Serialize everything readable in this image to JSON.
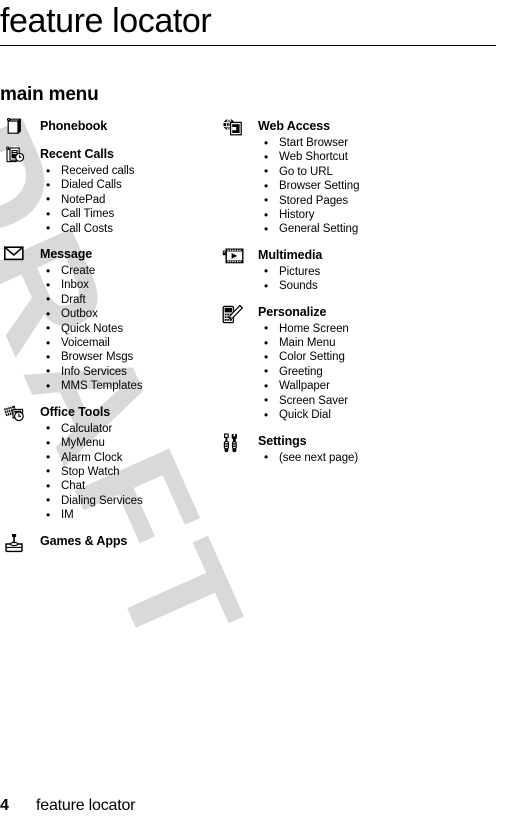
{
  "document": {
    "title": "feature locator",
    "section_heading": "main menu",
    "watermark_text": "DRAFT",
    "watermark_color": "#d9d9d9"
  },
  "footer": {
    "page_number": "4",
    "label": "feature locator"
  },
  "columns": {
    "left": [
      {
        "icon": "phonebook-icon",
        "label": "Phonebook",
        "items": []
      },
      {
        "icon": "recent-calls-icon",
        "label": "Recent Calls",
        "items": [
          "Received calls",
          "Dialed Calls",
          "NotePad",
          "Call Times",
          "Call Costs"
        ]
      },
      {
        "icon": "message-envelope-icon",
        "label": "Message",
        "items": [
          "Create",
          "Inbox",
          "Draft",
          "Outbox",
          "Quick Notes",
          "Voicemail",
          "Browser Msgs",
          "Info Services",
          "MMS Templates"
        ]
      },
      {
        "icon": "office-tools-icon",
        "label": "Office Tools",
        "items": [
          "Calculator",
          "MyMenu",
          "Alarm Clock",
          "Stop Watch",
          "Chat",
          "Dialing Services",
          "IM"
        ]
      },
      {
        "icon": "games-joystick-icon",
        "label": "Games & Apps",
        "items": []
      }
    ],
    "right": [
      {
        "icon": "web-access-globe-icon",
        "label": "Web Access",
        "items": [
          "Start Browser",
          "Web Shortcut",
          "Go to URL",
          "Browser Setting",
          "Stored Pages",
          "History",
          "General Setting"
        ]
      },
      {
        "icon": "multimedia-filmstrip-icon",
        "label": "Multimedia",
        "items": [
          "Pictures",
          "Sounds"
        ]
      },
      {
        "icon": "personalize-phone-pencil-icon",
        "label": "Personalize",
        "items": [
          "Home Screen",
          "Main Menu",
          "Color Setting",
          "Greeting",
          "Wallpaper",
          "Screen Saver",
          "Quick Dial"
        ]
      },
      {
        "icon": "settings-tools-icon",
        "label": "Settings",
        "items": [
          "(see next page)"
        ]
      }
    ]
  }
}
